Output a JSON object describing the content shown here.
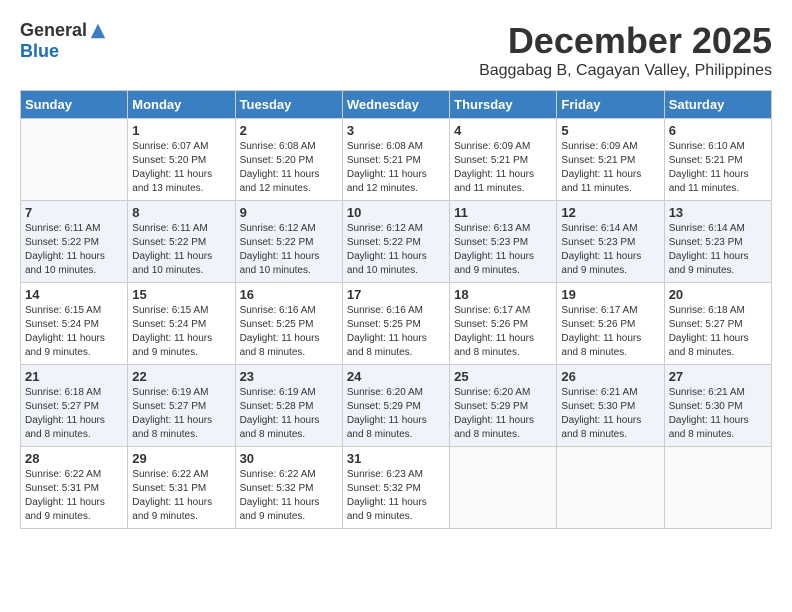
{
  "logo": {
    "general": "General",
    "blue": "Blue"
  },
  "title": "December 2025",
  "location": "Baggabag B, Cagayan Valley, Philippines",
  "days_of_week": [
    "Sunday",
    "Monday",
    "Tuesday",
    "Wednesday",
    "Thursday",
    "Friday",
    "Saturday"
  ],
  "weeks": [
    [
      {
        "day": "",
        "info": ""
      },
      {
        "day": "1",
        "info": "Sunrise: 6:07 AM\nSunset: 5:20 PM\nDaylight: 11 hours\nand 13 minutes."
      },
      {
        "day": "2",
        "info": "Sunrise: 6:08 AM\nSunset: 5:20 PM\nDaylight: 11 hours\nand 12 minutes."
      },
      {
        "day": "3",
        "info": "Sunrise: 6:08 AM\nSunset: 5:21 PM\nDaylight: 11 hours\nand 12 minutes."
      },
      {
        "day": "4",
        "info": "Sunrise: 6:09 AM\nSunset: 5:21 PM\nDaylight: 11 hours\nand 11 minutes."
      },
      {
        "day": "5",
        "info": "Sunrise: 6:09 AM\nSunset: 5:21 PM\nDaylight: 11 hours\nand 11 minutes."
      },
      {
        "day": "6",
        "info": "Sunrise: 6:10 AM\nSunset: 5:21 PM\nDaylight: 11 hours\nand 11 minutes."
      }
    ],
    [
      {
        "day": "7",
        "info": "Sunrise: 6:11 AM\nSunset: 5:22 PM\nDaylight: 11 hours\nand 10 minutes."
      },
      {
        "day": "8",
        "info": "Sunrise: 6:11 AM\nSunset: 5:22 PM\nDaylight: 11 hours\nand 10 minutes."
      },
      {
        "day": "9",
        "info": "Sunrise: 6:12 AM\nSunset: 5:22 PM\nDaylight: 11 hours\nand 10 minutes."
      },
      {
        "day": "10",
        "info": "Sunrise: 6:12 AM\nSunset: 5:22 PM\nDaylight: 11 hours\nand 10 minutes."
      },
      {
        "day": "11",
        "info": "Sunrise: 6:13 AM\nSunset: 5:23 PM\nDaylight: 11 hours\nand 9 minutes."
      },
      {
        "day": "12",
        "info": "Sunrise: 6:14 AM\nSunset: 5:23 PM\nDaylight: 11 hours\nand 9 minutes."
      },
      {
        "day": "13",
        "info": "Sunrise: 6:14 AM\nSunset: 5:23 PM\nDaylight: 11 hours\nand 9 minutes."
      }
    ],
    [
      {
        "day": "14",
        "info": "Sunrise: 6:15 AM\nSunset: 5:24 PM\nDaylight: 11 hours\nand 9 minutes."
      },
      {
        "day": "15",
        "info": "Sunrise: 6:15 AM\nSunset: 5:24 PM\nDaylight: 11 hours\nand 9 minutes."
      },
      {
        "day": "16",
        "info": "Sunrise: 6:16 AM\nSunset: 5:25 PM\nDaylight: 11 hours\nand 8 minutes."
      },
      {
        "day": "17",
        "info": "Sunrise: 6:16 AM\nSunset: 5:25 PM\nDaylight: 11 hours\nand 8 minutes."
      },
      {
        "day": "18",
        "info": "Sunrise: 6:17 AM\nSunset: 5:26 PM\nDaylight: 11 hours\nand 8 minutes."
      },
      {
        "day": "19",
        "info": "Sunrise: 6:17 AM\nSunset: 5:26 PM\nDaylight: 11 hours\nand 8 minutes."
      },
      {
        "day": "20",
        "info": "Sunrise: 6:18 AM\nSunset: 5:27 PM\nDaylight: 11 hours\nand 8 minutes."
      }
    ],
    [
      {
        "day": "21",
        "info": "Sunrise: 6:18 AM\nSunset: 5:27 PM\nDaylight: 11 hours\nand 8 minutes."
      },
      {
        "day": "22",
        "info": "Sunrise: 6:19 AM\nSunset: 5:27 PM\nDaylight: 11 hours\nand 8 minutes."
      },
      {
        "day": "23",
        "info": "Sunrise: 6:19 AM\nSunset: 5:28 PM\nDaylight: 11 hours\nand 8 minutes."
      },
      {
        "day": "24",
        "info": "Sunrise: 6:20 AM\nSunset: 5:29 PM\nDaylight: 11 hours\nand 8 minutes."
      },
      {
        "day": "25",
        "info": "Sunrise: 6:20 AM\nSunset: 5:29 PM\nDaylight: 11 hours\nand 8 minutes."
      },
      {
        "day": "26",
        "info": "Sunrise: 6:21 AM\nSunset: 5:30 PM\nDaylight: 11 hours\nand 8 minutes."
      },
      {
        "day": "27",
        "info": "Sunrise: 6:21 AM\nSunset: 5:30 PM\nDaylight: 11 hours\nand 8 minutes."
      }
    ],
    [
      {
        "day": "28",
        "info": "Sunrise: 6:22 AM\nSunset: 5:31 PM\nDaylight: 11 hours\nand 9 minutes."
      },
      {
        "day": "29",
        "info": "Sunrise: 6:22 AM\nSunset: 5:31 PM\nDaylight: 11 hours\nand 9 minutes."
      },
      {
        "day": "30",
        "info": "Sunrise: 6:22 AM\nSunset: 5:32 PM\nDaylight: 11 hours\nand 9 minutes."
      },
      {
        "day": "31",
        "info": "Sunrise: 6:23 AM\nSunset: 5:32 PM\nDaylight: 11 hours\nand 9 minutes."
      },
      {
        "day": "",
        "info": ""
      },
      {
        "day": "",
        "info": ""
      },
      {
        "day": "",
        "info": ""
      }
    ]
  ]
}
